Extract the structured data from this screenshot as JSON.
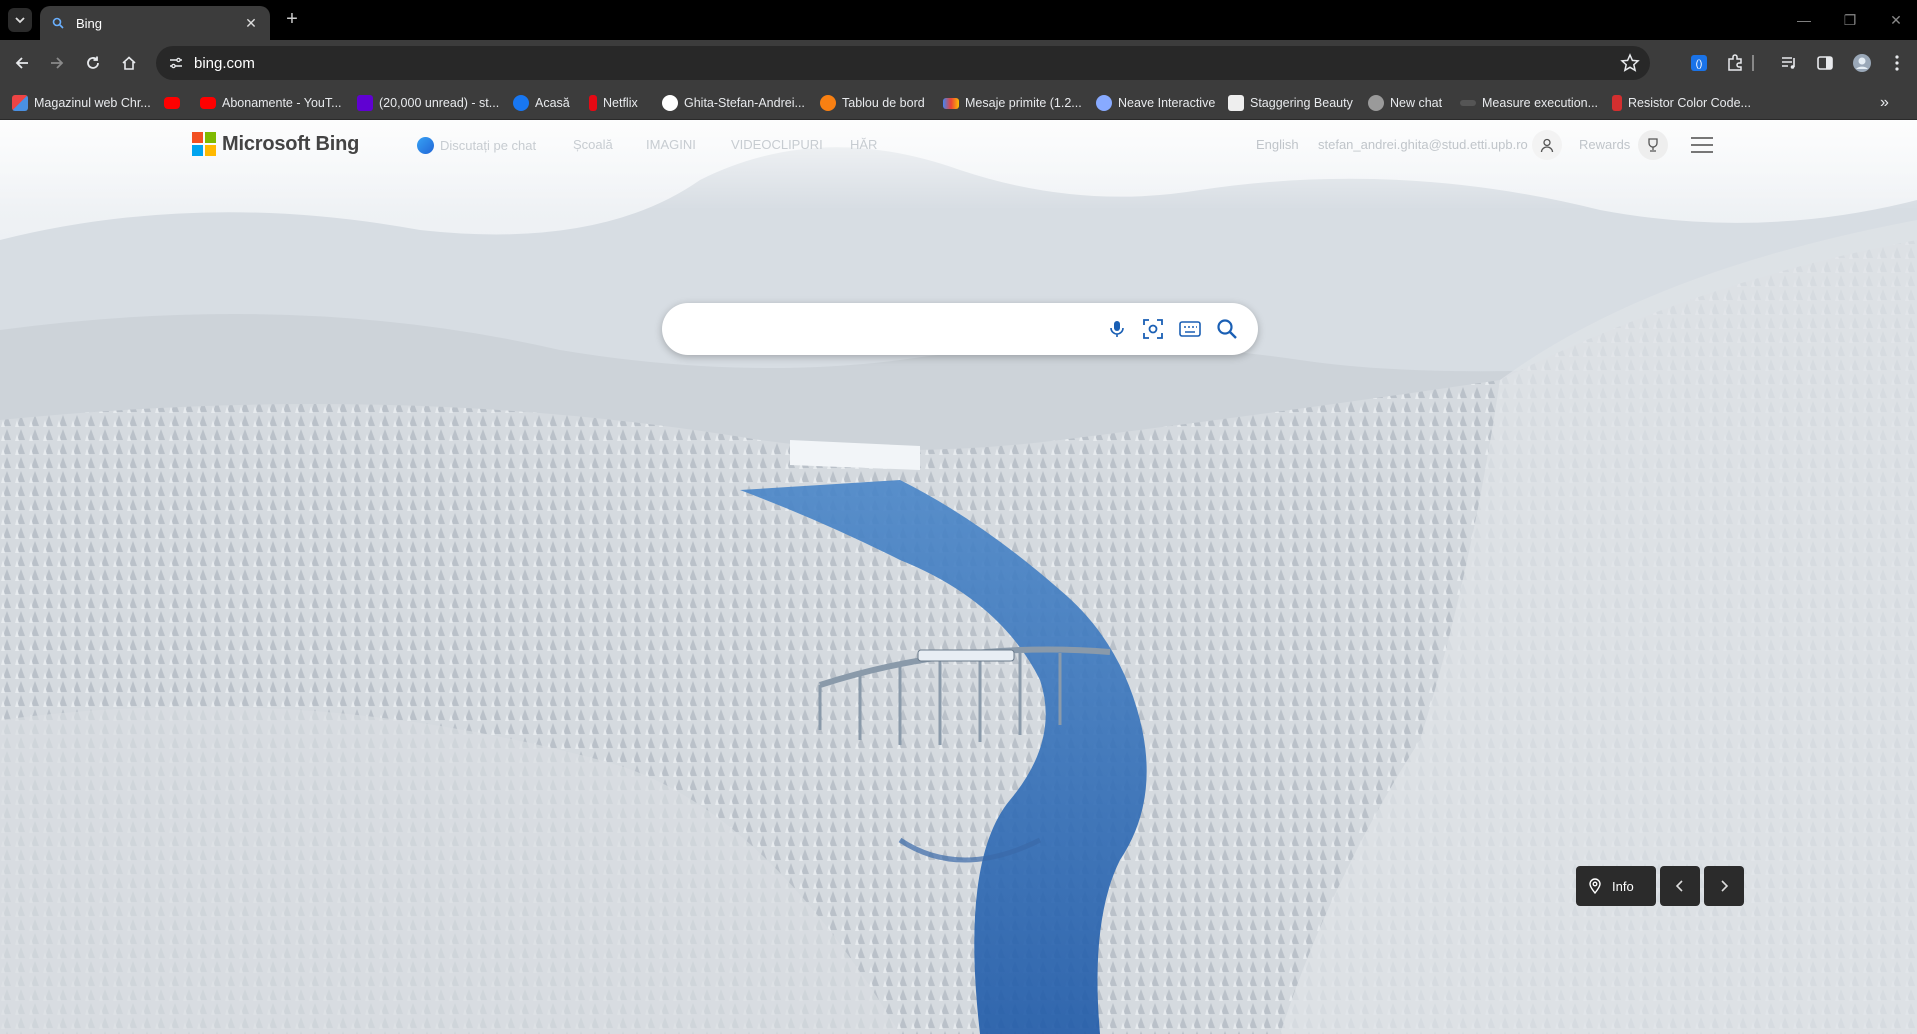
{
  "browser": {
    "tab": {
      "title": "Bing"
    },
    "url": "bing.com",
    "bookmarks": [
      {
        "label": "Magazinul web Chr...",
        "icon": "chrome-web-store-icon",
        "color": "#e44"
      },
      {
        "label": "",
        "icon": "youtube-icon",
        "color": "#ff0000"
      },
      {
        "label": "Abonamente - YouT...",
        "icon": "youtube-icon",
        "color": "#ff0000"
      },
      {
        "label": "(20,000 unread) - st...",
        "icon": "yahoo-mail-icon",
        "color": "#6001d2"
      },
      {
        "label": "Acasă",
        "icon": "facebook-icon",
        "color": "#1877f2"
      },
      {
        "label": "Netflix",
        "icon": "netflix-icon",
        "color": "#e50914"
      },
      {
        "label": "Ghita-Stefan-Andrei...",
        "icon": "github-icon",
        "color": "#ffffff"
      },
      {
        "label": "Tablou de bord",
        "icon": "moodle-icon",
        "color": "#f98012"
      },
      {
        "label": "Mesaje primite (1.2...",
        "icon": "gmail-icon",
        "color": "#ea4335"
      },
      {
        "label": "Neave Interactive",
        "icon": "neave-icon",
        "color": "#88aaff"
      },
      {
        "label": "Staggering Beauty",
        "icon": "staggering-beauty-icon",
        "color": "#eeeeee"
      },
      {
        "label": "New chat",
        "icon": "openai-icon",
        "color": "#cccccc"
      },
      {
        "label": "Measure execution...",
        "icon": "page-icon",
        "color": "#555555"
      },
      {
        "label": "Resistor Color Code...",
        "icon": "resistor-icon",
        "color": "#d32f2f"
      }
    ]
  },
  "bing": {
    "logo_text": "Microsoft Bing",
    "nav": {
      "chat": "Discutați pe chat",
      "school": "Școală",
      "images": "IMAGINI",
      "videos": "VIDEOCLIPURI",
      "more": "HĂR"
    },
    "language": "English",
    "account_email": "stefan_andrei.ghita@stud.etti.upb.ro",
    "rewards": "Rewards",
    "search": {
      "value": "",
      "placeholder": ""
    },
    "info_label": "Info"
  },
  "colors": {
    "bing_logo": [
      "#f25022",
      "#7fba00",
      "#00a4ef",
      "#ffb900"
    ]
  }
}
